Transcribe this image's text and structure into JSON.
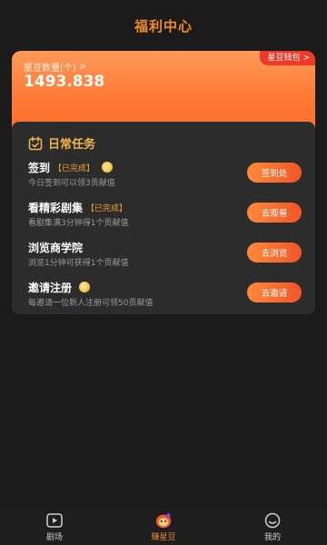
{
  "header": {
    "title": "福利中心"
  },
  "balance": {
    "label": "星豆数量(个)",
    "arrow": ">",
    "value": "1493.838",
    "wallet_label": "星豆钱包",
    "wallet_arrow": ">"
  },
  "tasks": {
    "title": "日常任务",
    "items": [
      {
        "name": "签到",
        "status": "【已完成】",
        "desc": "今日签到可以领3贡献值",
        "button": "签到处",
        "coin": true
      },
      {
        "name": "看精彩剧集",
        "status": "【已完成】",
        "desc": "看剧集满3分钟得1个贡献值",
        "button": "去观看",
        "coin": false
      },
      {
        "name": "浏览商学院",
        "status": "",
        "desc": "浏览1分钟可获得1个贡献值",
        "button": "去浏览",
        "coin": false
      },
      {
        "name": "邀请注册",
        "status": "",
        "desc": "每邀请一位新人注册可领50贡献值",
        "button": "去邀请",
        "coin": true
      }
    ]
  },
  "nav": {
    "items": [
      {
        "label": "剧场",
        "icon": "play-icon"
      },
      {
        "label": "赚星豆",
        "icon": "star-bean-icon"
      },
      {
        "label": "我的",
        "icon": "profile-icon"
      }
    ]
  },
  "colors": {
    "accent": "#f08a2c",
    "card_gradient_start": "#ff9a58",
    "card_gradient_end": "#ff6b2a",
    "badge": "#ef3a2a",
    "panel": "#2c2c2c",
    "background": "#1b1b1b"
  }
}
